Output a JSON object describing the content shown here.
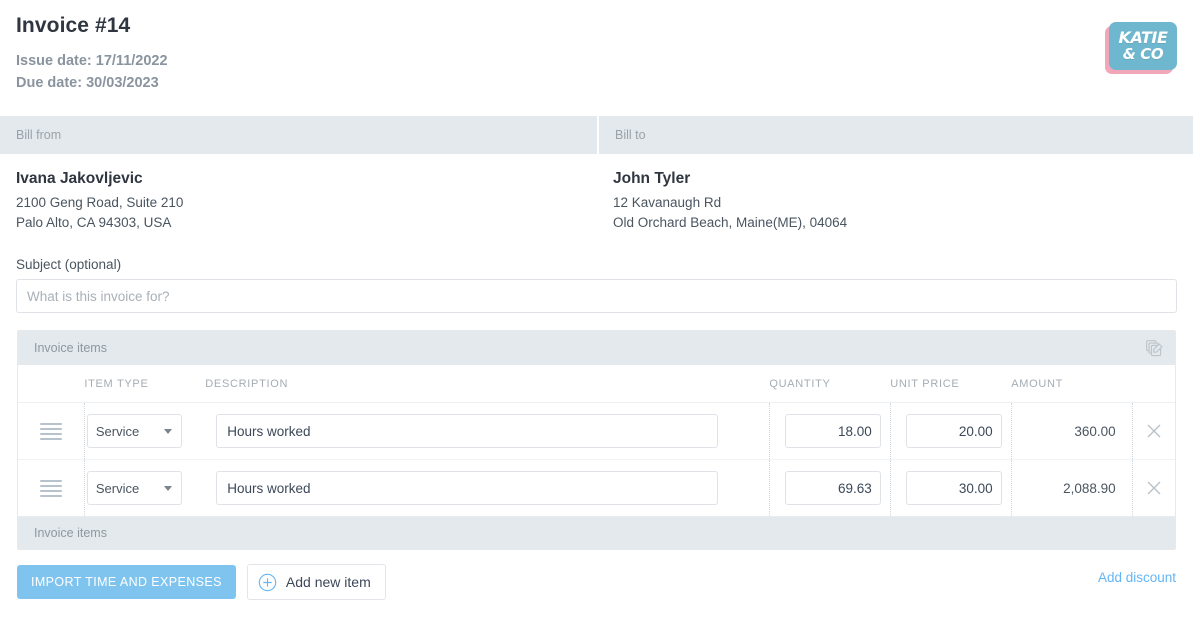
{
  "header": {
    "title": "Invoice #14",
    "issue_date_line": "Issue date: 17/11/2022",
    "due_date_line": "Due date: 30/03/2023",
    "logo": {
      "line1": "KATIE",
      "line2": "& CO",
      "box_color": "#6fb7ce",
      "shadow_color": "#f2a7b9",
      "text_color": "#ffffff"
    }
  },
  "bill": {
    "from_label": "Bill from",
    "to_label": "Bill to",
    "from": {
      "name": "Ivana Jakovljevic",
      "line1": "2100 Geng Road, Suite 210",
      "line2": "Palo Alto, CA 94303, USA"
    },
    "to": {
      "name": "John Tyler",
      "line1": "12 Kavanaugh Rd",
      "line2": "Old Orchard Beach, Maine(ME), 04064"
    }
  },
  "subject": {
    "label": "Subject (optional)",
    "placeholder": "What is this invoice for?",
    "value": ""
  },
  "items_card": {
    "header_label": "Invoice items",
    "footer_label": "Invoice items",
    "duplicate_icon": "copy-edit-icon",
    "columns": {
      "item_type": "ITEM TYPE",
      "description": "DESCRIPTION",
      "quantity": "QUANTITY",
      "unit_price": "UNIT PRICE",
      "amount": "AMOUNT"
    },
    "rows": [
      {
        "item_type": "Service",
        "description": "Hours worked",
        "quantity": "18.00",
        "unit_price": "20.00",
        "amount": "360.00"
      },
      {
        "item_type": "Service",
        "description": "Hours worked",
        "quantity": "69.63",
        "unit_price": "30.00",
        "amount": "2,088.90"
      }
    ]
  },
  "actions": {
    "import_label": "IMPORT TIME AND EXPENSES",
    "add_item_label": "Add new item",
    "add_discount_label": "Add discount",
    "import_color": "#7ec4ef",
    "link_color": "#64b5f6"
  }
}
